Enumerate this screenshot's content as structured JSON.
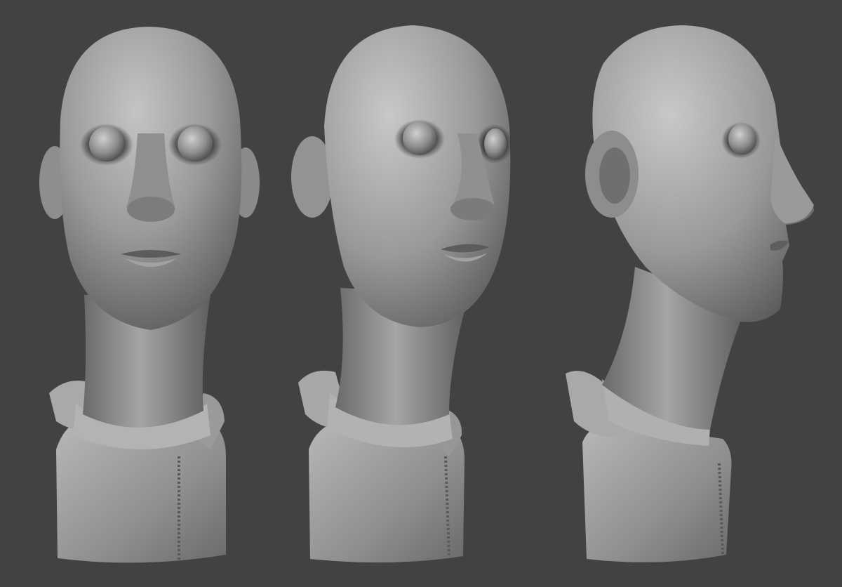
{
  "scene": {
    "background_color": "#424242",
    "material_color": "#a3a3a3",
    "shadow_color": "#1e1e1e",
    "highlight_color": "#d2d2d2",
    "busts": [
      {
        "id": "front",
        "view": "front"
      },
      {
        "id": "three-quarter",
        "view": "three-quarter"
      },
      {
        "id": "profile",
        "view": "profile-right"
      }
    ]
  }
}
